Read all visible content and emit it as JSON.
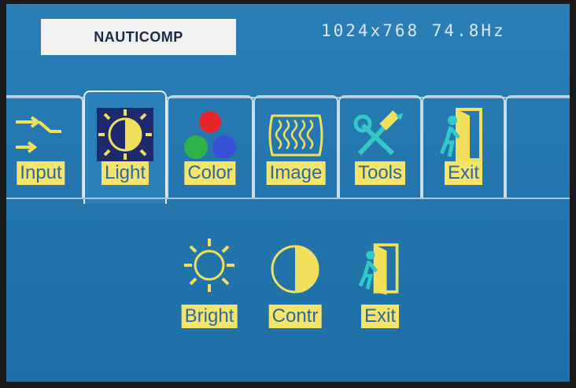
{
  "header": {
    "brand": "NAUTICOMP",
    "resolution": "1024x768 74.8Hz"
  },
  "tabs": [
    {
      "id": "input",
      "label": "Input",
      "icon": "input-arrows-icon",
      "active": false
    },
    {
      "id": "light",
      "label": "Light",
      "icon": "sun-contrast-icon",
      "active": true
    },
    {
      "id": "color",
      "label": "Color",
      "icon": "rgb-dots-icon",
      "active": false
    },
    {
      "id": "image",
      "label": "Image",
      "icon": "wave-image-icon",
      "active": false
    },
    {
      "id": "tools",
      "label": "Tools",
      "icon": "hammer-wrench-icon",
      "active": false
    },
    {
      "id": "exit",
      "label": "Exit",
      "icon": "exit-door-icon",
      "active": false
    }
  ],
  "submenu": [
    {
      "id": "bright",
      "label": "Bright",
      "icon": "sun-icon"
    },
    {
      "id": "contr",
      "label": "Contr",
      "icon": "half-circle-contrast-icon"
    },
    {
      "id": "exit",
      "label": "Exit",
      "icon": "exit-door-icon"
    }
  ],
  "colors": {
    "accent_yellow": "#f5e46a",
    "label_text": "#2a6aa0",
    "background_blue": "#2477ae"
  }
}
